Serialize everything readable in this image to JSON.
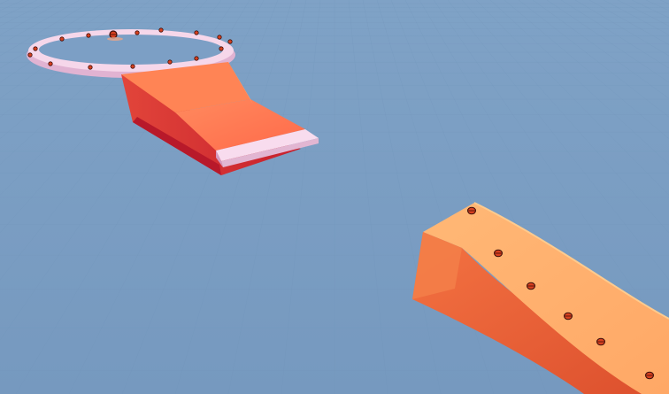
{
  "scene": {
    "background_color": "#7b9fc4",
    "grid_color": "#6f93b8",
    "colors": {
      "ring": "#f3d1e6",
      "ring_shadow": "#e5b7d4",
      "ramp_top": "#ff7a53",
      "ramp_top_light": "#ff9a6e",
      "ramp_side": "#d83a35",
      "ramp_side_dark": "#c7282f",
      "slab": "#f4d4ea",
      "slab_shadow": "#e0b3cf",
      "track_top": "#ffb070",
      "track_top_light": "#ffc184",
      "track_side": "#f06a3d",
      "track_side_dark": "#e0532f",
      "marker_fill": "#d8401f",
      "marker_outline": "#3d0f0b"
    },
    "objects": [
      {
        "name": "pink-ring-platform",
        "type": "ring"
      },
      {
        "name": "red-ramp-block",
        "type": "ramp"
      },
      {
        "name": "pink-slab",
        "type": "slab"
      },
      {
        "name": "orange-curved-track",
        "type": "track"
      }
    ],
    "ring_marker_count": 15,
    "track_marker_count": 6
  }
}
